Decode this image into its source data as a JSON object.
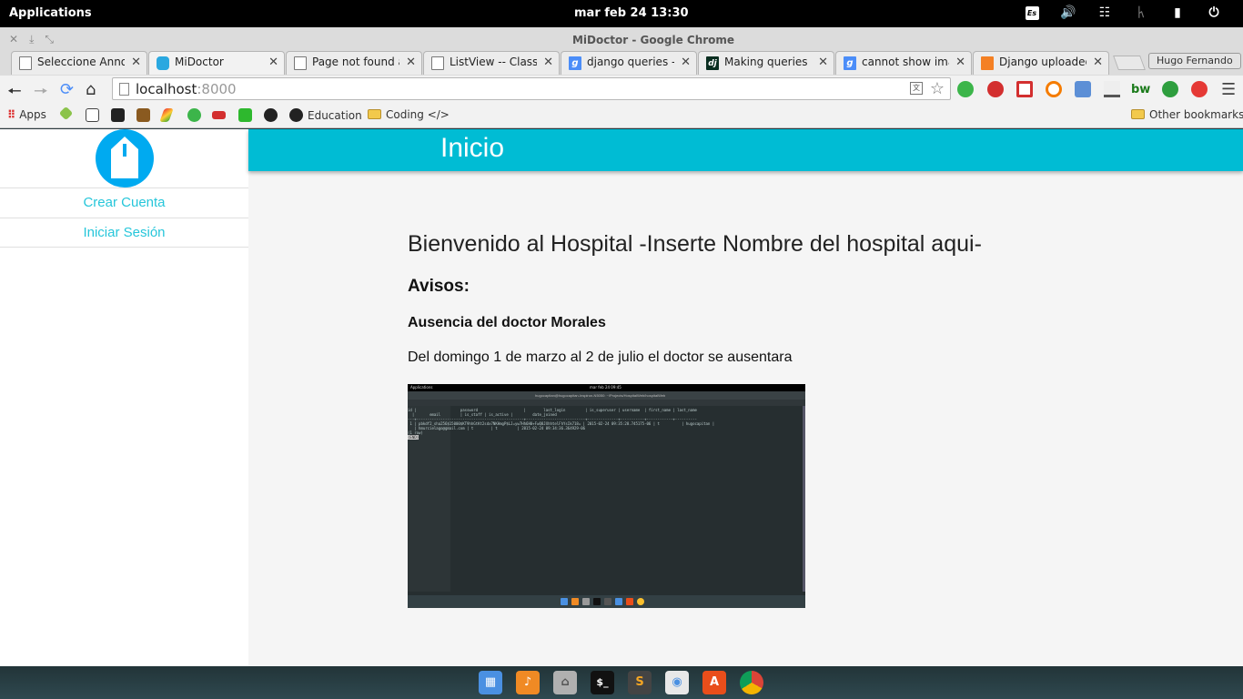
{
  "topbar": {
    "applications": "Applications",
    "clock": "mar feb 24    13:30",
    "keyboard_layout": "Es"
  },
  "window": {
    "title": "MiDoctor - Google Chrome",
    "user": "Hugo Fernando"
  },
  "tabs": [
    {
      "label": "Seleccione Announ",
      "favicon": "page-icon"
    },
    {
      "label": "MiDoctor",
      "favicon": "midoctor-icon"
    },
    {
      "label": "Page not found at",
      "favicon": "page-icon"
    },
    {
      "label": "ListView -- Classy C",
      "favicon": "page-icon"
    },
    {
      "label": "django queries - B",
      "favicon": "google-icon"
    },
    {
      "label": "Making queries | D",
      "favicon": "django-icon"
    },
    {
      "label": "cannot show imag",
      "favicon": "google-icon"
    },
    {
      "label": "Django uploaded i",
      "favicon": "stackoverflow-icon"
    }
  ],
  "omnibox": {
    "host": "localhost",
    "port": ":8000"
  },
  "bookmarks": {
    "apps": "Apps",
    "education": "Education",
    "coding": "Coding </>",
    "other": "Other bookmarks"
  },
  "sidebar": {
    "create_account": "Crear Cuenta",
    "login": "Iniciar Sesión"
  },
  "header": {
    "title": "Inicio"
  },
  "main": {
    "welcome": "Bienvenido al Hospital -Inserte Nombre del hospital aqui-",
    "notices_heading": "Avisos:",
    "notice_title": "Ausencia del doctor Morales",
    "notice_body": "Del domingo 1 de marzo al 2 de julio el doctor se ausentara"
  },
  "embedded_screenshot": {
    "top_left": "Applications",
    "clock": "mar feb 24   09:45",
    "window_title": "hugocapitan@hugocapitan-Inspiron-N5050: ~/Projects/HospitalWeb/hospitalWeb",
    "terminal_lines": [
      "id |                    password                     |        last_login         | is_superuser | username  | first_name | last_name",
      "  |       email         | is_staff | is_active |         date_joined",
      "---+-------------------------------------------------+---------------------------+--------------+-----------+------------+----------",
      " 1 | pbkdf2_sha256$15000$KT9hhGtKt2sdx7NKHmgP$LJ=yw7Hh6H0+FwQ8JXhhtelFhYsIk718= | 2015-02-24 09:35:28.745175-06 | t          | hugocapitan |",
      "   | hmurcielago@gmail.com | t        | t         | 2015-02-24 09:34:36.364929-06",
      "(1 row)",
      "",
      "(END)"
    ]
  },
  "colors": {
    "accent_teal": "#00bcd4",
    "link_teal": "#26c6da",
    "logo_blue": "#00aaf0"
  }
}
